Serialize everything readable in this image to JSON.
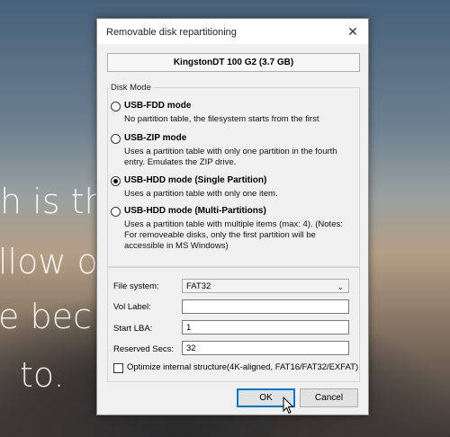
{
  "background": {
    "lines": [
      "h is th",
      "llow o",
      "e bec",
      "to."
    ]
  },
  "dialog": {
    "title": "Removable disk repartitioning",
    "close_icon": "close-icon",
    "device": "KingstonDT 100 G2 (3.7 GB)",
    "disk_mode": {
      "label": "Disk Mode",
      "options": [
        {
          "label": "USB-FDD mode",
          "desc": "No partition table, the filesystem starts from the first",
          "selected": false
        },
        {
          "label": "USB-ZIP mode",
          "desc": "Uses a partition table with only one partition in the fourth entry. Emulates the ZIP drive.",
          "selected": false
        },
        {
          "label": "USB-HDD mode (Single Partition)",
          "desc": "Uses a partition table with only one item.",
          "selected": true
        },
        {
          "label": "USB-HDD mode (Multi-Partitions)",
          "desc": "Uses a partition table with multiple items (max: 4). (Notes: For removeable disks, only the first partition will be accessible in MS Windows)",
          "selected": false
        }
      ]
    },
    "form": {
      "file_system_label": "File system:",
      "file_system_value": "FAT32",
      "vol_label_label": "Vol Label:",
      "vol_label_value": "",
      "start_lba_label": "Start LBA:",
      "start_lba_value": "1",
      "reserved_secs_label": "Reserved Secs:",
      "reserved_secs_value": "32",
      "optimize_label": "Optimize internal structure(4K-aligned, FAT16/FAT32/EXFAT)",
      "optimize_checked": false
    },
    "buttons": {
      "ok": "OK",
      "cancel": "Cancel"
    }
  }
}
